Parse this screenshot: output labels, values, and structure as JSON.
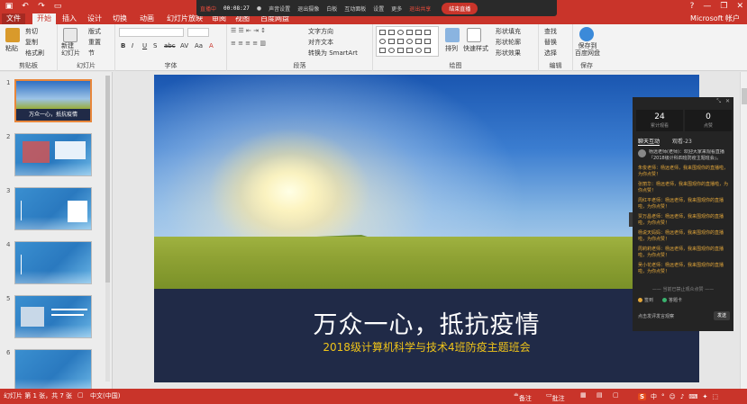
{
  "titlebar": {
    "quick_access": [
      "save-icon",
      "undo-icon",
      "redo-icon",
      "slideshow-icon"
    ],
    "window_controls": [
      "help-icon",
      "minimize-icon",
      "restore-icon",
      "close-icon"
    ]
  },
  "livebar": {
    "status": "直播中",
    "timer": "00:08:27",
    "items": [
      "声音设置",
      "退出摄像",
      "白板",
      "互动面板",
      "设置",
      "更多"
    ],
    "exit_share": "退出共享",
    "end_live": "结束直播"
  },
  "tabs": {
    "file": "文件",
    "items": [
      "开始",
      "插入",
      "设计",
      "切换",
      "动画",
      "幻灯片放映",
      "审阅",
      "视图",
      "百度网盘"
    ],
    "active": "开始",
    "account": "Microsoft 帐户"
  },
  "ribbon": {
    "clipboard": {
      "paste": "粘贴",
      "cut": "剪切",
      "copy": "复制",
      "format_painter": "格式刷",
      "label": "剪贴板"
    },
    "slides": {
      "new_slide": "新建\n幻灯片",
      "layout": "版式",
      "reset": "重置",
      "section": "节",
      "label": "幻灯片"
    },
    "font": {
      "label": "字体",
      "buttons": [
        "B",
        "I",
        "U",
        "S",
        "abc",
        "AV",
        "Aa",
        "A"
      ]
    },
    "paragraph": {
      "text_direction": "文字方向",
      "align_text": "对齐文本",
      "smartart": "转换为 SmartArt",
      "label": "段落"
    },
    "drawing": {
      "arrange": "排列",
      "quick_styles": "快速样式",
      "shape_fill": "形状填充",
      "shape_outline": "形状轮廓",
      "shape_effects": "形状效果",
      "label": "绘图"
    },
    "editing": {
      "find": "查找",
      "replace": "替换",
      "select": "选择",
      "label": "编辑"
    },
    "save": {
      "save_to_baidu": "保存到\n百度网盘",
      "label": "保存"
    }
  },
  "thumbnails": [
    {
      "num": "1",
      "title": "万众一心，抵抗疫情",
      "selected": true
    },
    {
      "num": "2",
      "title": ""
    },
    {
      "num": "3",
      "title": ""
    },
    {
      "num": "4",
      "title": ""
    },
    {
      "num": "5",
      "title": ""
    },
    {
      "num": "6",
      "title": ""
    }
  ],
  "slide": {
    "title": "万众一心，抵抗疫情",
    "subtitle": "2018级计算机科学与技术4班防疫主题班会"
  },
  "chat": {
    "stats": [
      {
        "value": "24",
        "label": "累计观看"
      },
      {
        "value": "0",
        "label": "点赞"
      }
    ],
    "tabs": [
      "聊天互动",
      "观看-23"
    ],
    "messages": [
      {
        "text": "杨远老师(老师)：欢迎大家来观看直播『2018级计科四班防疫主题班会』。",
        "first": true
      },
      {
        "text": "朱俊老师：杨远老师，我来围观你的直播啦，为你点赞！"
      },
      {
        "text": "张丽华：杨远老师，我来围观你的直播啦，为你点赞！"
      },
      {
        "text": "周红平老师：杨远老师，我来围观你的直播啦，为你点赞！"
      },
      {
        "text": "贾万昌老师：杨远老师，我来围观你的直播啦，为你点赞！"
      },
      {
        "text": "杨说天妈妈：杨远老师，我来围观你的直播啦，为你点赞！"
      },
      {
        "text": "周莉莉老师：杨远老师，我来围观你的直播啦，为你点赞！"
      },
      {
        "text": "吴小花老师：杨远老师，我来围观你的直播啦，为你点赞！"
      }
    ],
    "notice": "—— 当前已禁止观众点赞 ——",
    "options": [
      {
        "label": "签到",
        "color": "#e3a73a"
      },
      {
        "label": "答题卡",
        "color": "#3ab36e"
      }
    ],
    "input_placeholder": "点击发评发言观察",
    "send": "发送"
  },
  "statusbar": {
    "slide_info": "幻灯片 第 1 张，共 7 张",
    "language": "中文(中国)",
    "notes": "备注",
    "comments": "批注",
    "ime": "中"
  }
}
